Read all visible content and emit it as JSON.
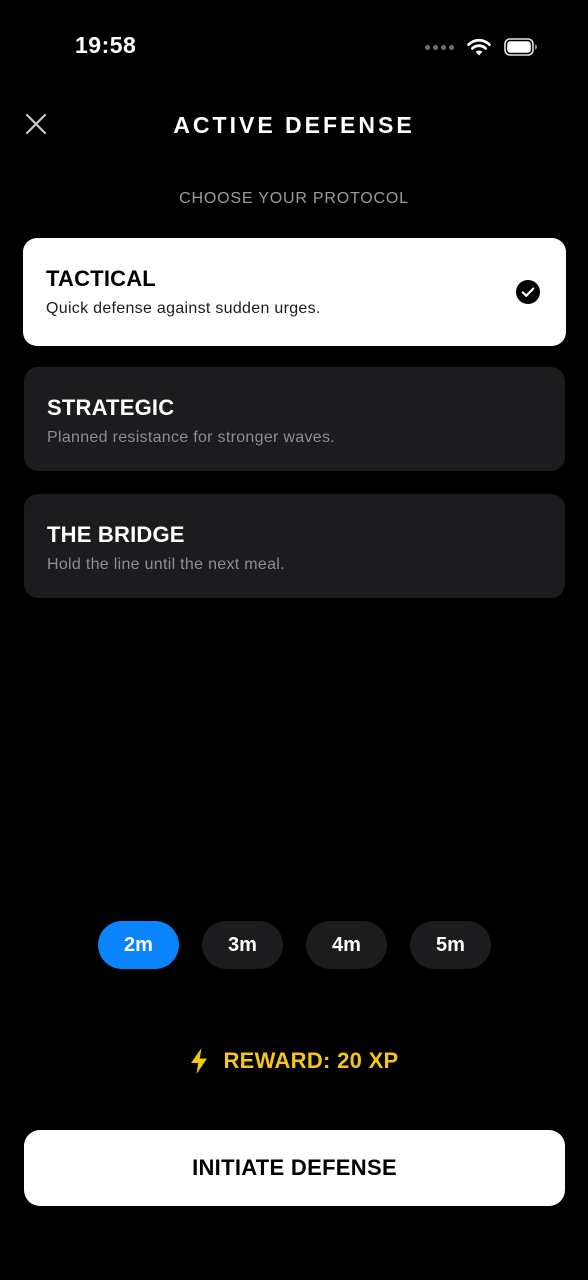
{
  "status_bar": {
    "time": "19:58",
    "icons": [
      "signal-dots-icon",
      "wifi-icon",
      "battery-icon"
    ]
  },
  "header": {
    "close_icon": "close-icon",
    "title": "ACTIVE DEFENSE"
  },
  "subtitle": "CHOOSE YOUR PROTOCOL",
  "protocols": [
    {
      "title": "TACTICAL",
      "description": "Quick defense against sudden urges.",
      "selected": true
    },
    {
      "title": "STRATEGIC",
      "description": "Planned resistance for stronger waves.",
      "selected": false
    },
    {
      "title": "THE BRIDGE",
      "description": "Hold the line until the next meal.",
      "selected": false
    }
  ],
  "durations": [
    {
      "label": "2m",
      "active": true
    },
    {
      "label": "3m",
      "active": false
    },
    {
      "label": "4m",
      "active": false
    },
    {
      "label": "5m",
      "active": false
    }
  ],
  "reward": {
    "icon": "lightning-icon",
    "label": "REWARD: 20 XP"
  },
  "cta_label": "INITIATE DEFENSE",
  "colors": {
    "background": "#000000",
    "card": "#1c1c1e",
    "selected_card": "#ffffff",
    "accent_blue": "#0a84ff",
    "reward_yellow": "#f5c518",
    "muted_text": "#8e8e93"
  }
}
